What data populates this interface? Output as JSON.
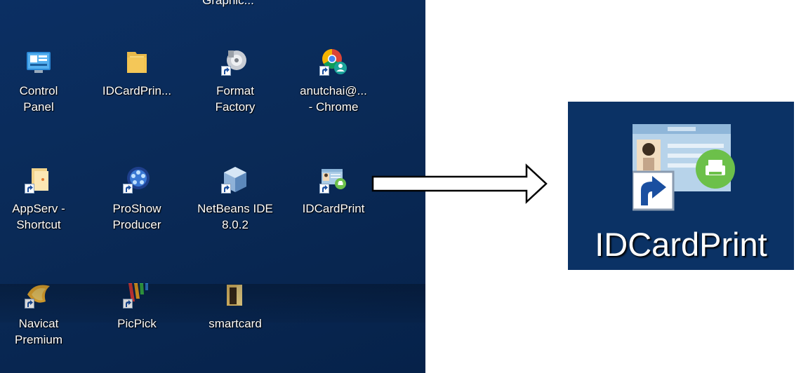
{
  "desktop": {
    "partial_top_label": "Graphic...",
    "icons": [
      {
        "line1": "Control",
        "line2": "Panel",
        "icon": "control-panel-icon"
      },
      {
        "line1": "IDCardPrin...",
        "line2": "",
        "icon": "folder-icon"
      },
      {
        "line1": "Format",
        "line2": "Factory",
        "icon": "format-factory-icon"
      },
      {
        "line1": "anutchai@...",
        "line2": "- Chrome",
        "icon": "chrome-profile-icon"
      },
      {
        "line1": "AppServ -",
        "line2": "Shortcut",
        "icon": "appserv-icon"
      },
      {
        "line1": "ProShow",
        "line2": "Producer",
        "icon": "proshow-icon"
      },
      {
        "line1": "NetBeans IDE",
        "line2": "8.0.2",
        "icon": "netbeans-icon"
      },
      {
        "line1": "IDCardPrint",
        "line2": "",
        "icon": "idcardprint-icon"
      },
      {
        "line1": "Navicat",
        "line2": "Premium",
        "icon": "navicat-icon"
      },
      {
        "line1": "PicPick",
        "line2": "",
        "icon": "picpick-icon"
      },
      {
        "line1": "smartcard",
        "line2": "",
        "icon": "smartcard-folder-icon"
      }
    ]
  },
  "zoom": {
    "label": "IDCardPrint",
    "icon": "idcardprint-icon"
  },
  "colors": {
    "desktop_bg": "#0b2f63",
    "print_badge": "#6cc04a"
  }
}
